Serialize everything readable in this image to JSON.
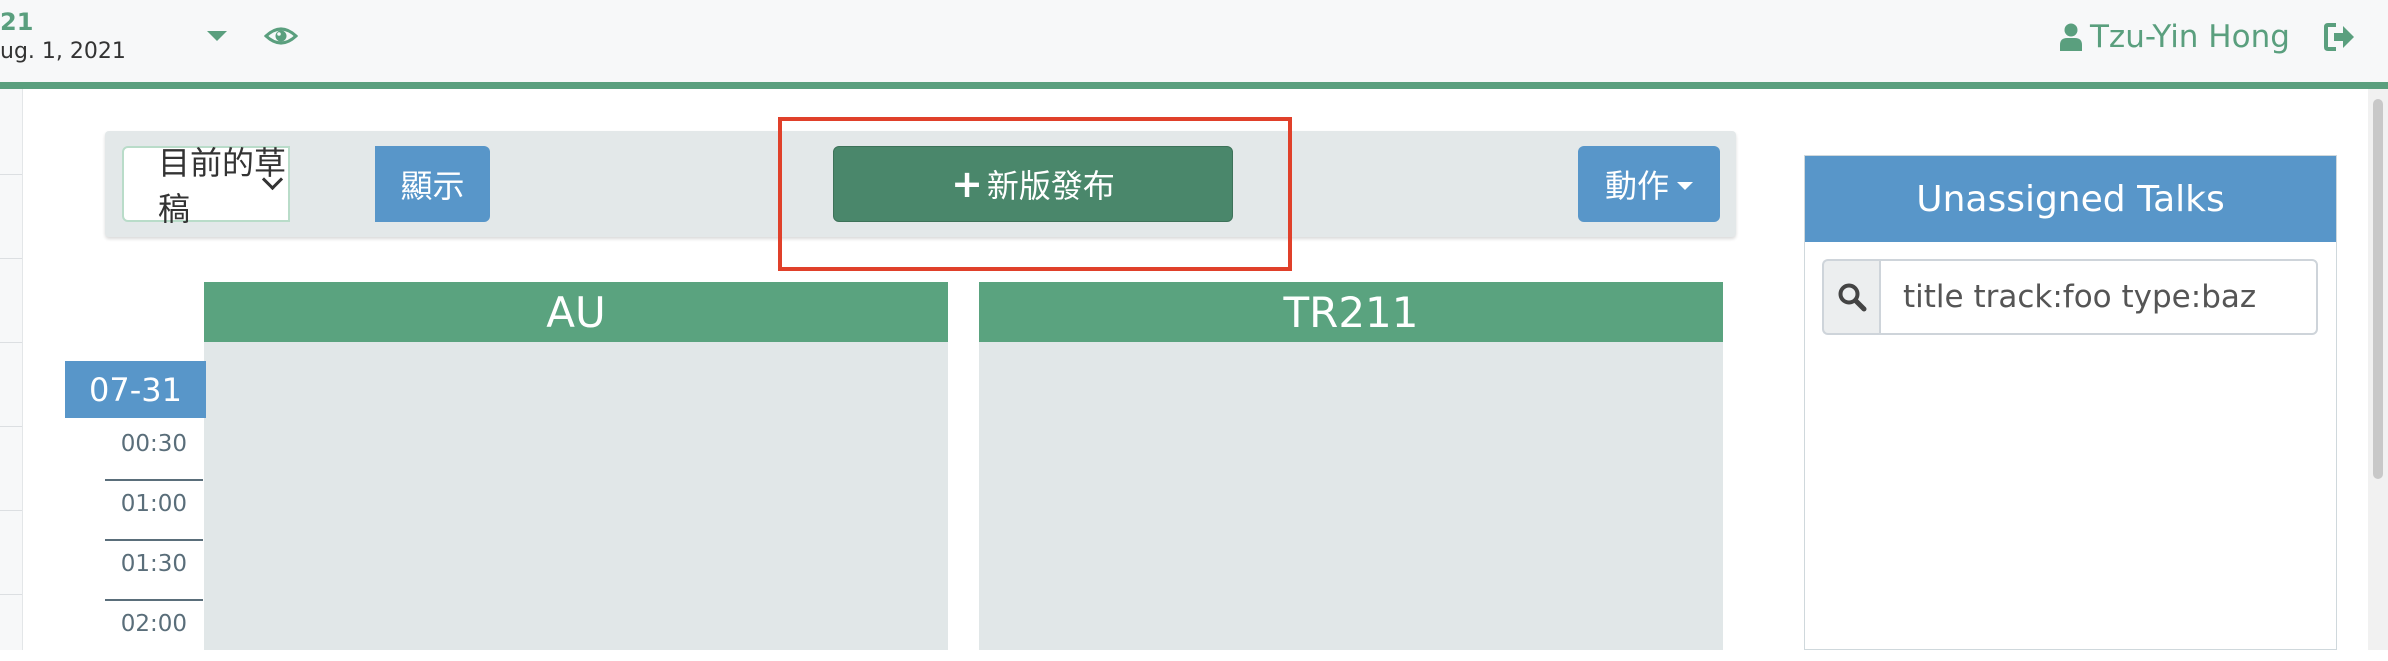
{
  "header": {
    "event_title_fragment": "21",
    "event_date_fragment": "ug. 1, 2021",
    "user_name": "Tzu-Yin Hong"
  },
  "toolbar": {
    "draft_select_value": "目前的草稿",
    "show_label": "顯示",
    "new_release_label": "新版發布",
    "actions_label": "動作"
  },
  "schedule": {
    "rooms": [
      "AU",
      "TR211"
    ],
    "day": "07-31",
    "times": [
      "00:30",
      "01:00",
      "01:30",
      "02:00"
    ]
  },
  "unassigned": {
    "title": "Unassigned Talks",
    "search_placeholder": "title track:foo type:baz"
  },
  "colors": {
    "brand_green": "#5a9f7e",
    "button_blue": "#5896c9",
    "primary_dark_green": "#4a876b",
    "highlight_red": "#e0402a"
  },
  "icons": {
    "visibility": "eye-icon",
    "dropdown": "caret-down-icon",
    "user": "user-icon",
    "logout": "sign-out-icon",
    "add": "plus-icon",
    "search": "search-icon"
  }
}
